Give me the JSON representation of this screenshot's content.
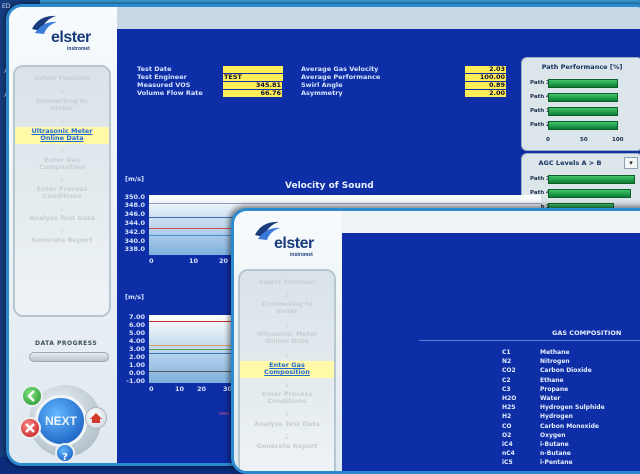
{
  "background_window": {
    "labels": [
      "ED",
      "a",
      "A",
      "A"
    ]
  },
  "window1": {
    "logo": {
      "word": "elster",
      "sub": "instromet"
    },
    "steps": [
      {
        "label": "Select Function",
        "active": false
      },
      {
        "label": "Connecting to meter",
        "active": false
      },
      {
        "label": "Ultrasonic Meter Online Data",
        "active": true
      },
      {
        "label": "Enter Gas Composition",
        "active": false
      },
      {
        "label": "Enter Process Conditions",
        "active": false
      },
      {
        "label": "Analyze Test Data",
        "active": false
      },
      {
        "label": "Generate Report",
        "active": false
      }
    ],
    "data_progress_label": "DATA PROGRESS",
    "data_progress_value": 0,
    "nav": {
      "next_label": "NEXT",
      "help_label": "?"
    },
    "info_left": [
      {
        "label": "Test Date",
        "value": ""
      },
      {
        "label": "Test Engineer",
        "value": "TEST"
      },
      {
        "label": "Measured VOS",
        "value": "345.81"
      },
      {
        "label": "Volume Flow Rate",
        "value": "66.76"
      }
    ],
    "info_right": [
      {
        "label": "Average Gas Velocity",
        "value": "2.03"
      },
      {
        "label": "Average Performance",
        "value": "100.00"
      },
      {
        "label": "Swirl Angle",
        "value": "0.89"
      },
      {
        "label": "Asymmetry",
        "value": "2.00"
      }
    ],
    "path_performance": {
      "title": "Path Performance [%]",
      "paths": [
        {
          "name": "Path 3",
          "value": 100
        },
        {
          "name": "Path 4",
          "value": 100
        },
        {
          "name": "Path 1",
          "value": 100
        },
        {
          "name": "Path 2",
          "value": 100
        }
      ],
      "axis": [
        "0",
        "50",
        "100"
      ]
    },
    "agc_levels": {
      "title": "AGC Levels A > B",
      "dropdown_icon": "chevron-down-icon",
      "paths": [
        {
          "name": "Path 3",
          "value": 92
        },
        {
          "name": "Path 4",
          "value": 88
        },
        {
          "name": "Path 1",
          "value": 70
        }
      ]
    },
    "vos_chart": {
      "unit": "[m/s]",
      "title": "Velocity of Sound",
      "yticks": [
        "350.0",
        "348.0",
        "346.0",
        "344.0",
        "342.0",
        "340.0",
        "338.0"
      ],
      "xticks": [
        "0",
        "10",
        "20"
      ]
    },
    "velocity_chart": {
      "unit": "[m/s]",
      "yticks": [
        "7.00",
        "6.00",
        "5.00",
        "4.00",
        "3.00",
        "2.00",
        "1.00",
        "0.00",
        "-1.00"
      ],
      "xticks": [
        "0",
        "10",
        "20",
        "30"
      ],
      "legend_fragment": "P"
    }
  },
  "window2": {
    "logo": {
      "word": "elster",
      "sub": "instromet"
    },
    "steps": [
      {
        "label": "Select Function",
        "active": false
      },
      {
        "label": "Connecting to meter",
        "active": false
      },
      {
        "label": "Ultrasonic Meter Online Data",
        "active": false
      },
      {
        "label": "Enter Gas Composition",
        "active": true
      },
      {
        "label": "Enter Process Conditions",
        "active": false
      },
      {
        "label": "Analyze Test Data",
        "active": false
      },
      {
        "label": "Generate Report",
        "active": false
      }
    ],
    "gas_composition": {
      "title": "GAS COMPOSITION",
      "rows": [
        {
          "code": "C1",
          "name": "Methane"
        },
        {
          "code": "N2",
          "name": "Nitrogen"
        },
        {
          "code": "CO2",
          "name": "Carbon Dioxide"
        },
        {
          "code": "C2",
          "name": "Ethane"
        },
        {
          "code": "C3",
          "name": "Propane"
        },
        {
          "code": "H2O",
          "name": "Water"
        },
        {
          "code": "H2S",
          "name": "Hydrogen Sulphide"
        },
        {
          "code": "H2",
          "name": "Hydrogen"
        },
        {
          "code": "CO",
          "name": "Carbon Monoxide"
        },
        {
          "code": "O2",
          "name": "Oxygen"
        },
        {
          "code": "iC4",
          "name": "i-Butane"
        },
        {
          "code": "nC4",
          "name": "n-Butane"
        },
        {
          "code": "iC5",
          "name": "i-Pentane"
        }
      ]
    }
  },
  "colors": {
    "accent": "#2b8ad0",
    "main_bg": "#0d2ea6",
    "value_bg": "#ffee55",
    "bar_green": "#0b7d35",
    "active_step": "#1f6ad6"
  }
}
